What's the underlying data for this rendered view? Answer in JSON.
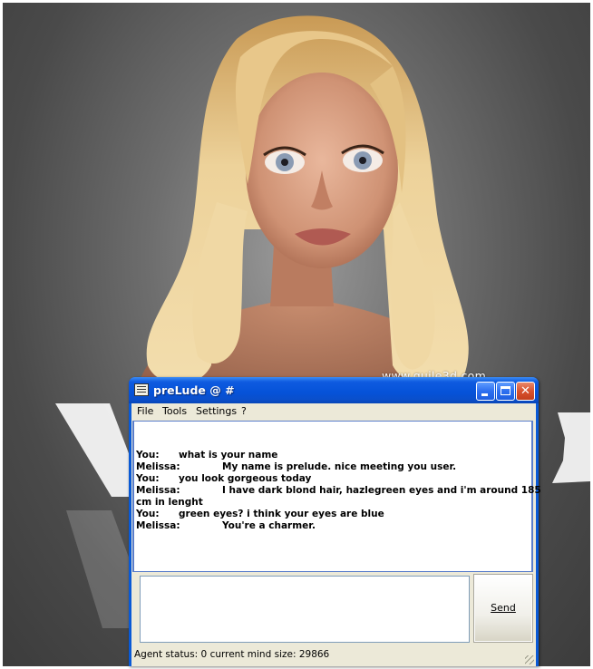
{
  "watermark": "www.guile3d.com",
  "window": {
    "title": "preLude @ #",
    "buttons": {
      "minimize": "minimize",
      "maximize": "maximize",
      "close": "close"
    }
  },
  "menu": {
    "items": [
      "File",
      "Tools",
      "Settings",
      "?"
    ]
  },
  "chat": {
    "lines": [
      {
        "speaker": "You:",
        "text": "what is your name"
      },
      {
        "speaker": "Melissa:",
        "text": "My name is prelude. nice meeting you user."
      },
      {
        "speaker": "You:",
        "text": "you look gorgeous today"
      },
      {
        "speaker": "Melissa:",
        "text": "I have dark blond hair, hazlegreen eyes and i'm around 185",
        "continuation": "cm in lenght"
      },
      {
        "speaker": "You:",
        "text": "green eyes? i think your eyes are blue"
      },
      {
        "speaker": "Melissa:",
        "text": "You're a charmer."
      }
    ]
  },
  "input": {
    "value": ""
  },
  "send_button": {
    "label": "Send"
  },
  "status": {
    "text": "Agent status: 0 current mind size: 29866"
  },
  "colors": {
    "titlebar": "#0552d8",
    "window_border": "#0a5ad6",
    "client_bg": "#ece9d8",
    "close_button": "#d8512e"
  },
  "icons": {
    "app": "notepad-icon",
    "minimize": "minimize-icon",
    "maximize": "maximize-icon",
    "close": "close-icon"
  }
}
